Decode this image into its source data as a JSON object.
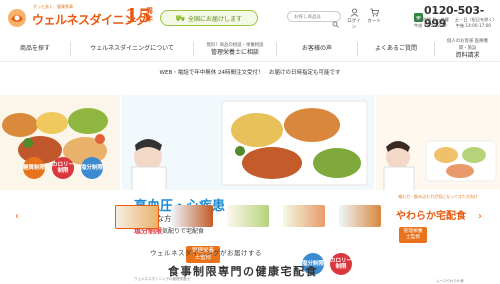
{
  "header": {
    "logo_tagline": "ずっと長く、健康食事",
    "logo_text": "ウェルネスダイニング",
    "anniversary_number": "15",
    "anniversary_unit": "周年",
    "national_delivery": "全国にお届けします",
    "search_placeholder": "お探し商品は",
    "login_label": "ログイン",
    "cart_label": "カート",
    "phone": "0120-503-999",
    "hours_line1": "営業時間 月～金曜",
    "hours_line2": "午前 9:30-12:30",
    "hours_line3": "土・日（祝日を除く）",
    "hours_line4": "午後 14:00-17:00"
  },
  "nav": {
    "items": [
      {
        "label": "商品を探す"
      },
      {
        "label": "ウェルネスダイニングについて"
      },
      {
        "small": "無料！商品の相談・栄養相談",
        "label": "管理栄養士に相談"
      },
      {
        "label": "お客様の声"
      },
      {
        "label": "よくあるご質問"
      },
      {
        "small": "個人のお客様 医療機関・施設",
        "label": "資料請求"
      }
    ]
  },
  "notice": "WEB・電話で年中無休 24時間注文受付！　お届けの日時指定も可能です",
  "slides": {
    "left_badges": [
      "糖質制限",
      "カロリー制限",
      "塩分制限"
    ],
    "main_title": "高血圧・心疾患",
    "main_sub": "が不安な方向け",
    "main_line": "塩分制限",
    "main_line_suffix": "気配りで宅配食",
    "main_supervisor": "管理栄養士監修",
    "main_caption": "ウェルネスダイニングの管理栄養士",
    "main_badges": [
      "塩分制限",
      "カロリー制限"
    ],
    "right_line1": "噛む力・飲み込む力が気になってきた方向け",
    "right_title": "やわらか宅配食",
    "right_supervisor": "管理栄養士監修",
    "right_caption": "ムースやわらか食"
  },
  "tagline": "ウェルネスダイニングがお届けする",
  "headline": "食事制限専門の健康宅配食"
}
